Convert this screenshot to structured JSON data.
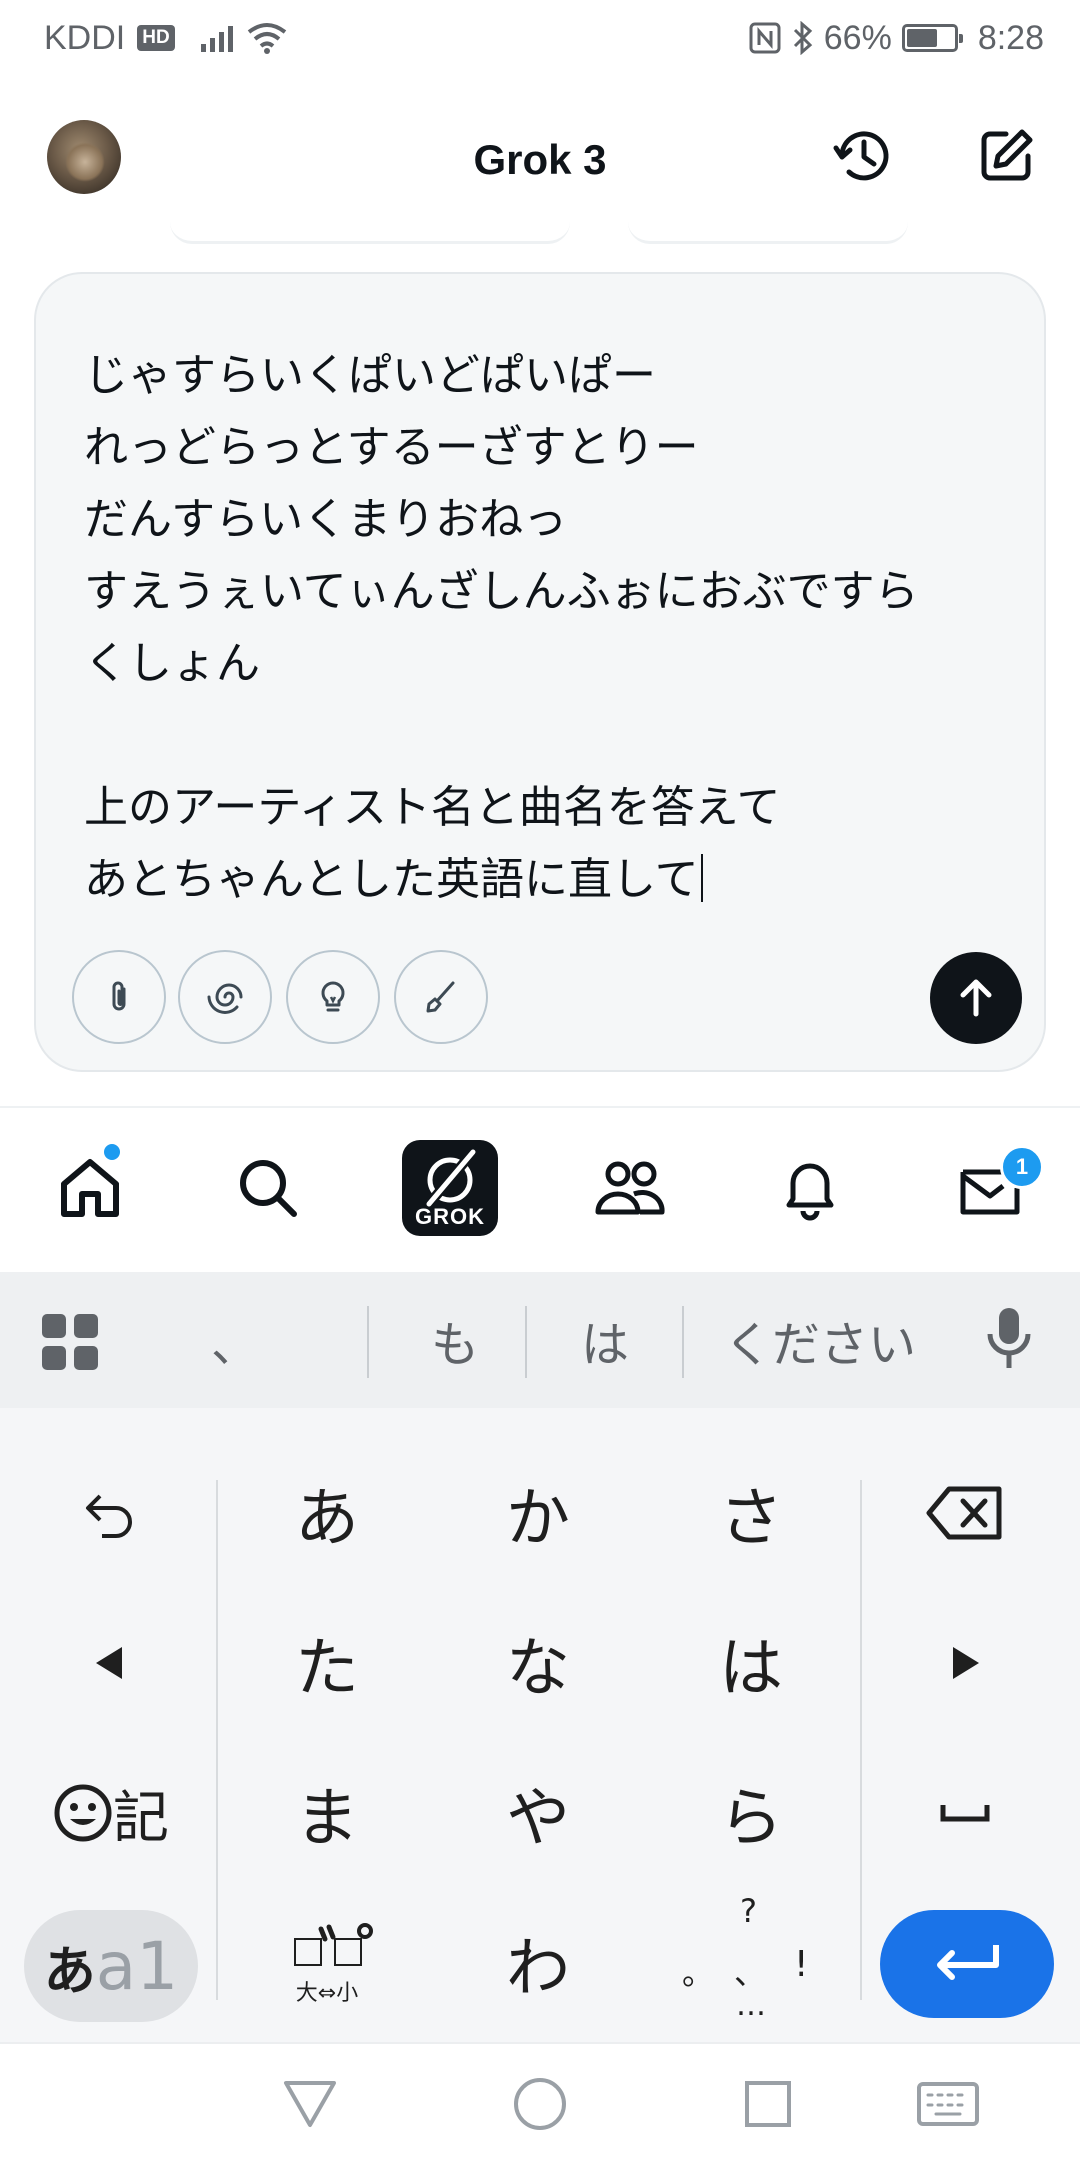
{
  "status_bar": {
    "carrier": "KDDI",
    "hd": "HD",
    "battery_percent": "66%",
    "battery_level": 0.66,
    "time": "8:28"
  },
  "header": {
    "title": "Grok 3"
  },
  "composer": {
    "prompt_text": "じゃすらいくぱいどぱいぱー\nれっどらっとするーざすとりー\nだんすらいくまりおねっ\nすえうぇいてぃんざしんふぉにおぶですら\nくしょん\n\n上のアーティスト名と曲名を答えて\nあとちゃんとした英語に直して",
    "tools": [
      "paperclip-icon",
      "swirl-icon",
      "lightbulb-icon",
      "brush-icon"
    ]
  },
  "nav": {
    "grok_label": "GROK",
    "mail_badge": "1"
  },
  "keyboard": {
    "candidates": [
      "、",
      "も",
      "は",
      "ください"
    ],
    "row1": [
      "あ",
      "か",
      "さ"
    ],
    "row2": [
      "た",
      "な",
      "は"
    ],
    "row3": [
      "ま",
      "や",
      "ら"
    ],
    "row4_center": "わ",
    "emoji_label": "記",
    "dakuten_label": "大⇔小",
    "mode_label_kana": "あ",
    "mode_label_latin": "a1",
    "punct_top": "?",
    "punct_bottom": "…",
    "punct_left": "。",
    "punct_mid": "、",
    "punct_right": "!"
  }
}
